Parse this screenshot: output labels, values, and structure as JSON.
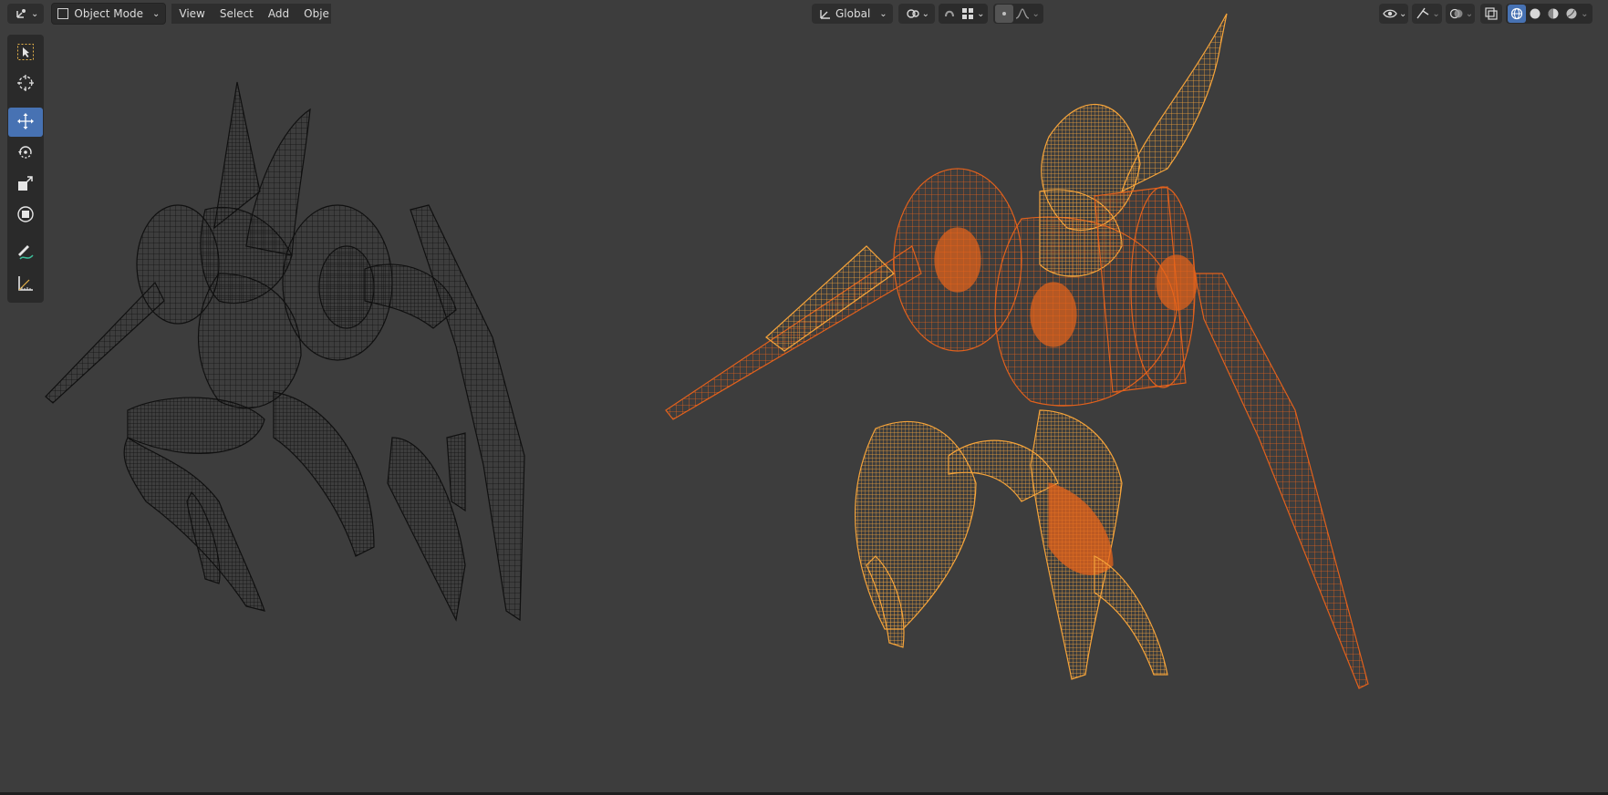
{
  "header": {
    "editor_type_icon": "3d-viewport-icon",
    "mode_label": "Object Mode",
    "menus": [
      "View",
      "Select",
      "Add",
      "Obje"
    ],
    "transform_orientation": "Global"
  },
  "toolbar": {
    "tools": [
      {
        "name": "select-box-tool",
        "icon": "select-box-icon",
        "active": false
      },
      {
        "name": "cursor-tool",
        "icon": "cursor-icon",
        "active": false
      },
      {
        "name": "move-tool",
        "icon": "move-icon",
        "active": true
      },
      {
        "name": "rotate-tool",
        "icon": "rotate-icon",
        "active": false
      },
      {
        "name": "scale-tool",
        "icon": "scale-icon",
        "active": false
      },
      {
        "name": "transform-tool",
        "icon": "transform-icon",
        "active": false
      },
      {
        "name": "annotate-tool",
        "icon": "annotate-icon",
        "active": false
      },
      {
        "name": "measure-tool",
        "icon": "measure-icon",
        "active": false
      }
    ]
  },
  "colors": {
    "viewport_bg": "#3d3d3d",
    "wire_unselected": "#0a0a0a",
    "wire_selected": "#f28c28",
    "wire_active": "#e8641a",
    "accent": "#4772b3"
  }
}
